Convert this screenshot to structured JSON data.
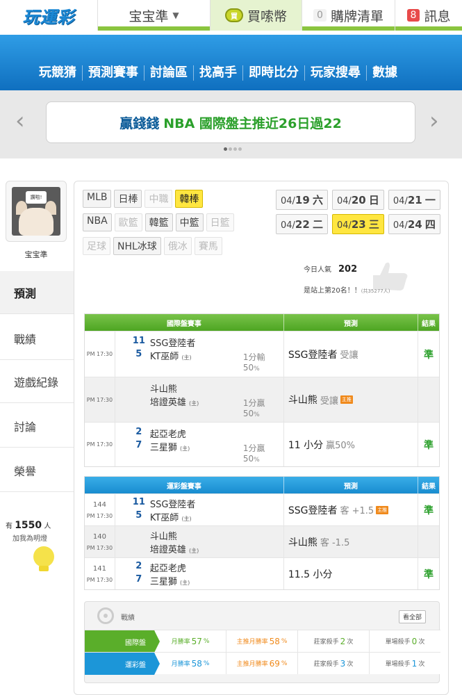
{
  "topbar": {
    "logo": "玩運彩",
    "user": "宝宝準",
    "coin_icon": "coin-badge",
    "coin_badge": "買",
    "coin_label": "買嗦幣",
    "cart_count": "0",
    "cart_label": "購牌清單",
    "msg_count": "8",
    "msg_label": "訊息"
  },
  "nav": [
    "玩競猜",
    "預測賽事",
    "討論區",
    "找高手",
    "即時比分",
    "玩家搜尋",
    "數據"
  ],
  "banner": {
    "part1": "贏錢錢",
    "part2": "NBA 國際盤主推近26日過22"
  },
  "sidebar": {
    "avatar_sign": "讚啦!",
    "user_name": "宝宝準",
    "items": [
      "預測",
      "戰績",
      "遊戲紀錄",
      "討論",
      "榮譽"
    ],
    "bulb_prefix": "有",
    "bulb_count": "1550",
    "bulb_suffix": "人",
    "bulb_sub": "加我為明燈"
  },
  "sports": {
    "row1": [
      "MLB",
      "日棒",
      "中職",
      "韓棒"
    ],
    "row2": [
      "NBA",
      "歐籃",
      "韓籃",
      "中籃",
      "日籃"
    ],
    "row3": [
      "足球",
      "NHL冰球",
      "俄冰",
      "賽馬"
    ]
  },
  "dates": {
    "row1": [
      {
        "m": "04/",
        "d": "19",
        "w": "六"
      },
      {
        "m": "04/",
        "d": "20",
        "w": "日"
      },
      {
        "m": "04/",
        "d": "21",
        "w": "一"
      }
    ],
    "row2": [
      {
        "m": "04/",
        "d": "22",
        "w": "二"
      },
      {
        "m": "04/",
        "d": "23",
        "w": "三"
      },
      {
        "m": "04/",
        "d": "24",
        "w": "四"
      }
    ]
  },
  "popularity": {
    "label": "今日人氣",
    "value": "202",
    "rank": "是站上第20名！！",
    "rank_total": "(共35277人)"
  },
  "intl": {
    "head": [
      "國際盤賽事",
      "預測",
      "結果"
    ],
    "rows": [
      {
        "time": "PM 17:30",
        "s1": "11",
        "s2": "5",
        "t1": "SSG登陸者",
        "t2": "KT巫師",
        "home": "(主)",
        "odds1": "1分輸",
        "odds2": "50",
        "pct": "%",
        "pred": "SSG登陸者",
        "pred_sub": "受讓",
        "tag": "",
        "res": "準"
      },
      {
        "time": "PM 17:30",
        "s1": "",
        "s2": "",
        "t1": "斗山熊",
        "t2": "培證英雄",
        "home": "(主)",
        "odds1": "1分贏",
        "odds2": "50",
        "pct": "%",
        "pred": "斗山熊",
        "pred_sub": "受讓",
        "tag": "主推",
        "res": ""
      },
      {
        "time": "PM 17:30",
        "s1": "2",
        "s2": "7",
        "t1": "起亞老虎",
        "t2": "三星獅",
        "home": "(主)",
        "odds1": "1分贏",
        "odds2": "50",
        "pct": "%",
        "pred": "11 小分",
        "pred_sub": "贏50%",
        "tag": "",
        "res": "準"
      }
    ]
  },
  "lottery": {
    "head": [
      "運彩盤賽事",
      "預測",
      "結果"
    ],
    "rows": [
      {
        "gid": "144",
        "time": "PM 17:30",
        "s1": "11",
        "s2": "5",
        "t1": "SSG登陸者",
        "t2": "KT巫師",
        "home": "(主)",
        "pred": "SSG登陸者",
        "pred_sub": "客 +1.5",
        "tag": "主推",
        "res": "準"
      },
      {
        "gid": "140",
        "time": "PM 17:30",
        "s1": "",
        "s2": "",
        "t1": "斗山熊",
        "t2": "培證英雄",
        "home": "(主)",
        "pred": "斗山熊",
        "pred_sub": "客 -1.5",
        "tag": "",
        "res": ""
      },
      {
        "gid": "141",
        "time": "PM 17:30",
        "s1": "2",
        "s2": "7",
        "t1": "起亞老虎",
        "t2": "三星獅",
        "home": "(主)",
        "pred": "11.5 小分",
        "pred_sub": "",
        "tag": "",
        "res": "準"
      }
    ]
  },
  "record": {
    "label": "戰績",
    "view_all": "看全部",
    "rows": [
      {
        "tag": "國際盤",
        "monthly_label": "月勝率",
        "monthly": "57",
        "main_label": "主推月勝率",
        "main": "58",
        "pct": "%",
        "bank_label": "莊家殺手",
        "bank": "2",
        "single_label": "單場殺手",
        "single": "0",
        "unit": "次"
      },
      {
        "tag": "運彩盤",
        "monthly_label": "月勝率",
        "monthly": "58",
        "main_label": "主推月勝率",
        "main": "69",
        "pct": "%",
        "bank_label": "莊家殺手",
        "bank": "3",
        "single_label": "單場殺手",
        "single": "1",
        "unit": "次"
      }
    ]
  }
}
